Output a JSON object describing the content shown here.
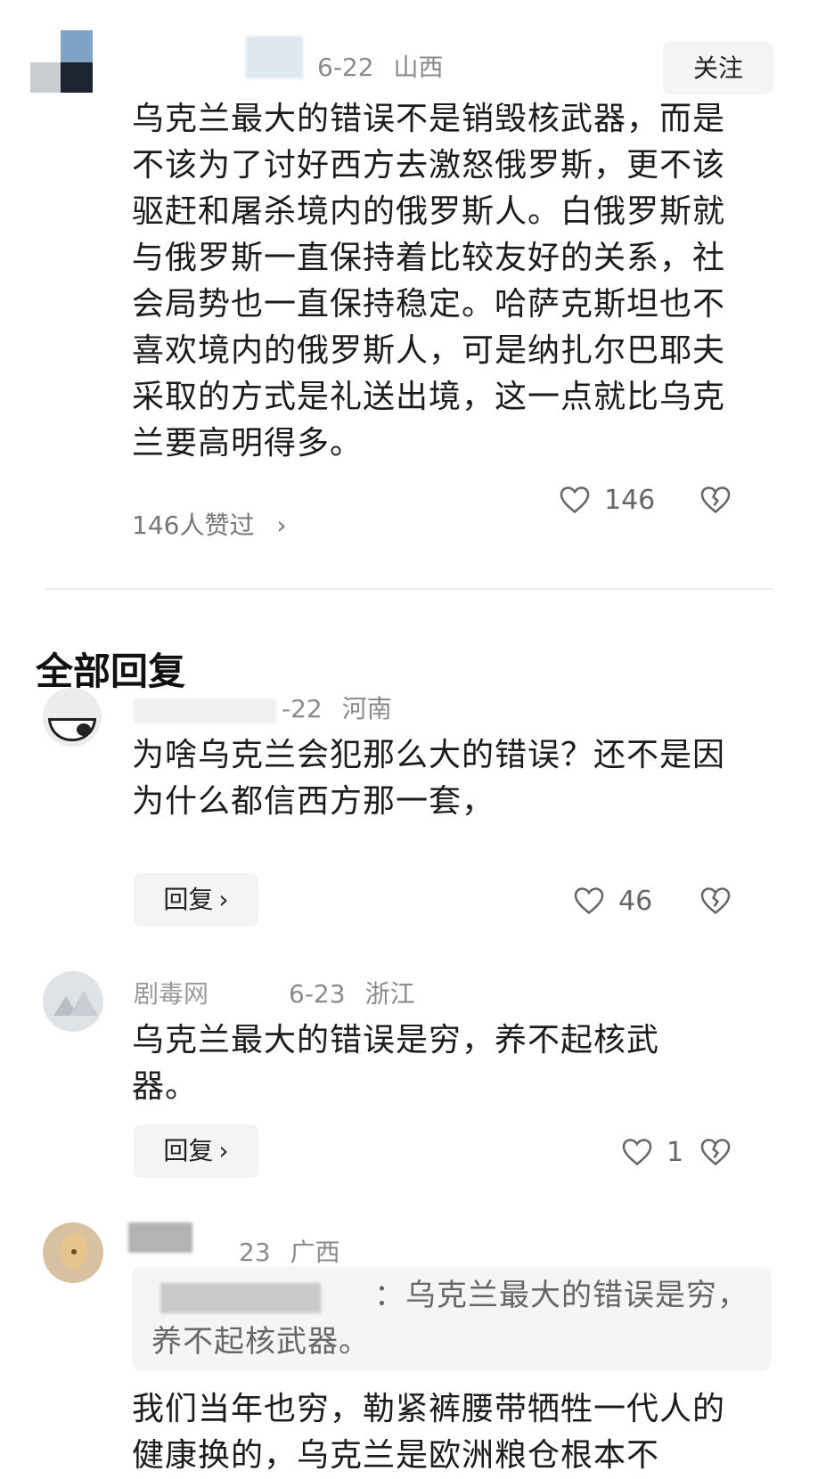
{
  "main_comment": {
    "date": "6-22",
    "location": "山西",
    "follow_label": "关注",
    "text": "乌克兰最大的错误不是销毁核武器，而是不该为了讨好西方去激怒俄罗斯，更不该驱赶和屠杀境内的俄罗斯人。白俄罗斯就与俄罗斯一直保持着比较友好的关系，社会局势也一直保持稳定。哈萨克斯坦也不喜欢境内的俄罗斯人，可是纳扎尔巴耶夫采取的方式是礼送出境，这一点就比乌克兰要高明得多。",
    "liked_by": "146人赞过",
    "like_count": "146"
  },
  "section_title": "全部回复",
  "replies": [
    {
      "date": "-22",
      "location": "河南",
      "text": "为啥乌克兰会犯那么大的错误？还不是因为什么都信西方那一套，",
      "reply_label": "回复",
      "like_count": "46"
    },
    {
      "username": "剧毒网",
      "date": "6-23",
      "location": "浙江",
      "text": "乌克兰最大的错误是穷，养不起核武器。",
      "reply_label": "回复",
      "like_count": "1"
    },
    {
      "date": "23",
      "location": "广西",
      "quote": "：乌克兰最大的错误是穷，养不起核武器。",
      "text": "我们当年也穷，勒紧裤腰带牺牲一代人的健康换的，乌克兰是欧洲粮仓根本不"
    }
  ],
  "icons": {
    "like": "heart-outline-icon",
    "dislike": "broken-heart-icon",
    "chevron": "chevron-right-icon"
  }
}
